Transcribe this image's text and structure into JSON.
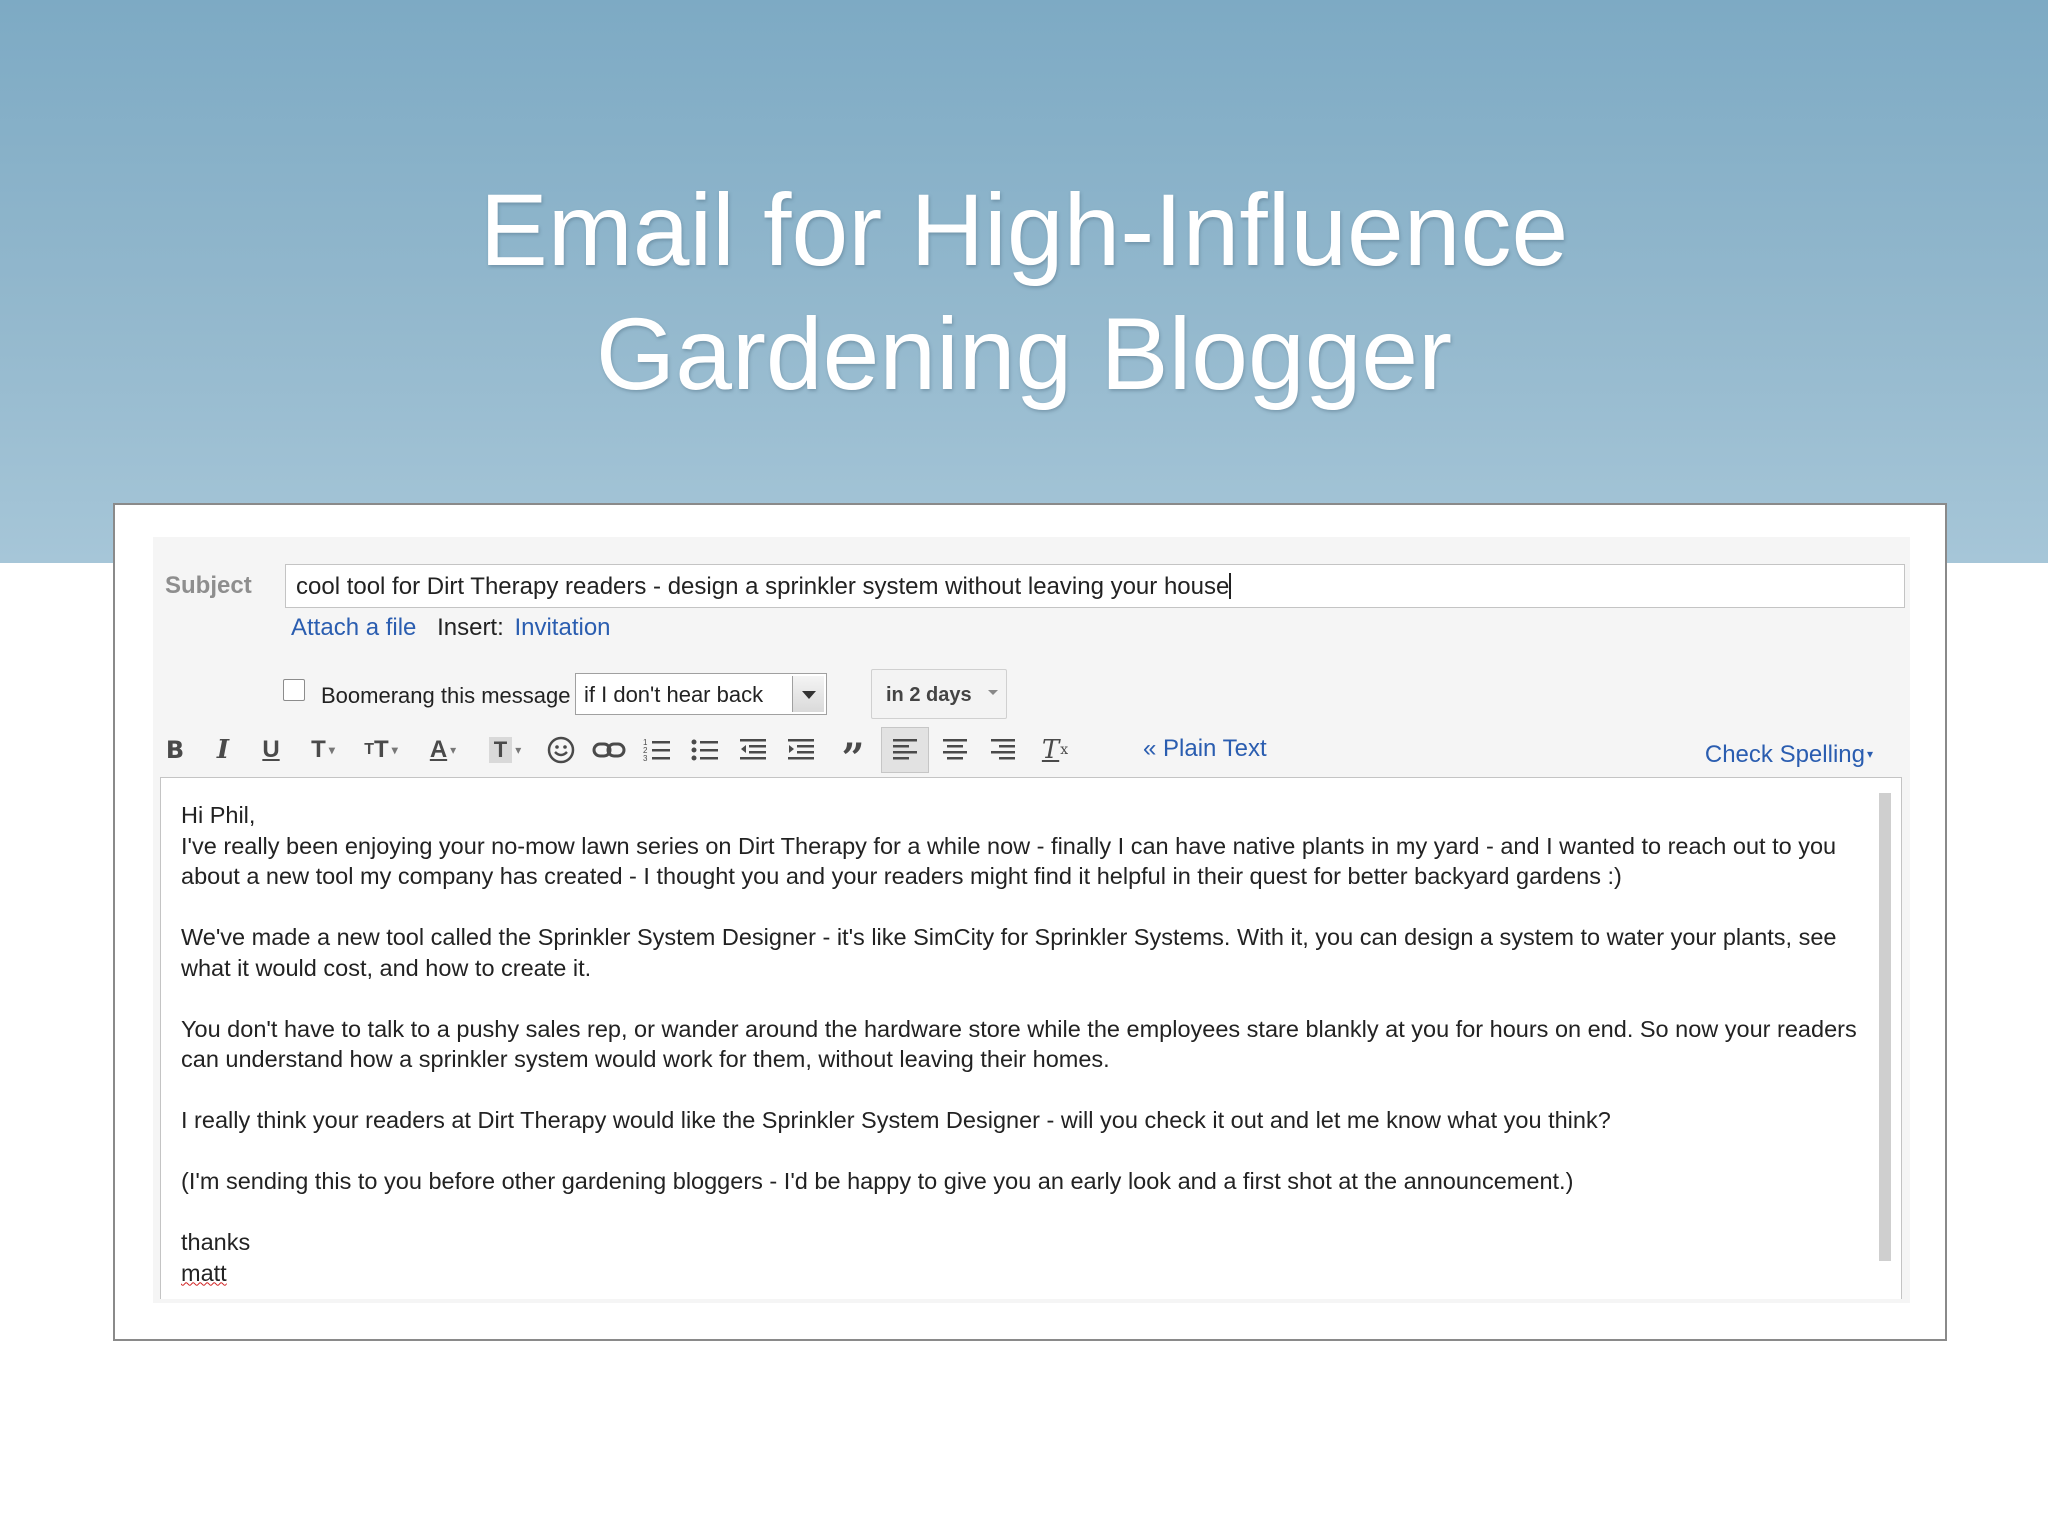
{
  "slide": {
    "title_line1": "Email for High-Influence",
    "title_line2": "Gardening Blogger"
  },
  "compose": {
    "subject_label": "Subject",
    "subject_value": "cool tool for Dirt Therapy readers - design a sprinkler system without leaving your house",
    "attach_label": "Attach a file",
    "insert_label": "Insert:",
    "invitation_label": "Invitation",
    "boomerang_label": "Boomerang this message",
    "boomerang_checked": false,
    "boomerang_condition": "if I don't hear back",
    "boomerang_delay": "in 2 days",
    "plain_text_label": "« Plain Text",
    "check_spelling_label": "Check Spelling",
    "toolbar_icons": [
      "bold-icon",
      "italic-icon",
      "underline-icon",
      "font-icon",
      "font-size-icon",
      "text-color-icon",
      "highlight-icon",
      "emoji-icon",
      "link-icon",
      "numbered-list-icon",
      "bulleted-list-icon",
      "indent-less-icon",
      "indent-more-icon",
      "quote-icon",
      "align-left-icon",
      "align-center-icon",
      "align-right-icon",
      "remove-formatting-icon"
    ],
    "body": {
      "greeting": "Hi Phil,",
      "p1": "I've really been enjoying your no-mow lawn series on Dirt Therapy for a while now - finally I can have native plants in my yard - and I wanted to reach out to you about a new tool my company has created - I thought you and your readers might find it helpful in their quest for better backyard gardens :)",
      "p2": "We've made a new tool called the Sprinkler System Designer - it's like SimCity for Sprinkler Systems.  With it, you can design a system to water your plants, see what it would cost, and how to create it.",
      "p3": "You don't have to talk to a pushy sales rep, or wander around the hardware store while the employees stare blankly at you for hours on end.  So now your readers can understand how a sprinkler system would work for them, without leaving their homes.",
      "p4": "I really think your readers at Dirt Therapy would like the Sprinkler System Designer - will you check it out and let me know what you think?",
      "p5": "(I'm sending this to you before other gardening bloggers - I'd be happy to give you an early look and a first shot at the announcement.)",
      "closing": "thanks",
      "signature": "matt"
    }
  }
}
